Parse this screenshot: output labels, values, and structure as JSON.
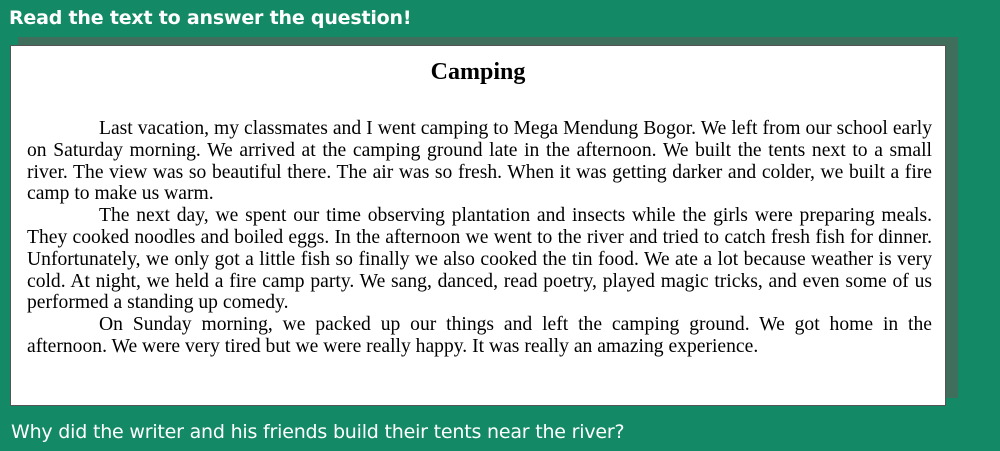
{
  "instruction": "Read the text to answer the question!",
  "passage": {
    "title": "Camping",
    "paragraphs": [
      "Last vacation, my classmates and I went camping to Mega Mendung Bogor. We left from our school early on Saturday morning. We arrived at the camping ground late in the afternoon. We built the tents next to a small river. The view was so beautiful there. The air was so fresh. When it was getting darker and colder, we built a fire camp to make us warm.",
      "The next day, we spent our time observing plantation and insects while the girls were preparing meals. They cooked noodles and boiled eggs. In the afternoon we went to the river and tried to catch fresh fish for dinner. Unfortunately, we only got a little fish so finally we also cooked the tin food. We ate a lot because weather is very cold. At night, we held a fire camp party. We sang, danced, read poetry, played magic tricks, and even some of us performed a standing up comedy.",
      "On Sunday morning, we packed up our things and left the camping ground. We got home in the afternoon. We were very tired but we were really happy. It was really an amazing experience."
    ]
  },
  "question": "Why did the writer and his friends build their tents near the river?",
  "colors": {
    "background": "#138a65",
    "card_shadow": "#3f6e5d",
    "card": "#ffffff"
  }
}
